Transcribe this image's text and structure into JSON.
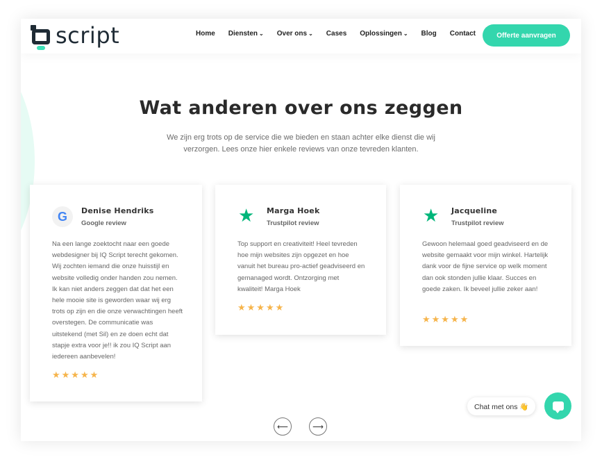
{
  "header": {
    "logo_text": "script",
    "nav": [
      {
        "label": "Home",
        "has_dropdown": false
      },
      {
        "label": "Diensten",
        "has_dropdown": true
      },
      {
        "label": "Over ons",
        "has_dropdown": true
      },
      {
        "label": "Cases",
        "has_dropdown": false
      },
      {
        "label": "Oplossingen",
        "has_dropdown": true
      },
      {
        "label": "Blog",
        "has_dropdown": false
      },
      {
        "label": "Contact",
        "has_dropdown": false
      }
    ],
    "cta_label": "Offerte aanvragen"
  },
  "section": {
    "title": "Wat anderen over ons zeggen",
    "subtitle": "We zijn erg trots op de service die we bieden en staan achter elke dienst die wij verzorgen. Lees onze hier enkele reviews van onze tevreden klanten."
  },
  "reviews": [
    {
      "name": "Denise Hendriks",
      "source": "Google review",
      "icon": "google-icon",
      "icon_glyph": "G",
      "rating": 5,
      "stars": "★★★★★",
      "text": "Na een lange zoektocht naar een goede webdesigner bij IQ Script terecht gekomen. Wij zochten iemand die onze huisstijl en website volledig onder handen zou nemen. Ik kan niet anders zeggen dat dat het een hele mooie site is geworden waar wij erg trots op zijn en die onze verwachtingen heeft overstegen. De communicatie was uitstekend (met Sil) en ze doen echt dat stapje extra voor je!! ik zou IQ Script aan iedereen aanbevelen!"
    },
    {
      "name": "Marga Hoek",
      "source": "Trustpilot review",
      "icon": "trustpilot-star-icon",
      "icon_glyph": "★",
      "rating": 5,
      "stars": "★★★★★",
      "text": "Top support en creativiteit! Heel tevreden hoe mijn websites zijn opgezet en hoe vanuit het bureau pro-actief geadviseerd en gemanaged wordt. Ontzorging met kwaliteit! Marga Hoek"
    },
    {
      "name": "Jacqueline",
      "source": "Trustpilot review",
      "icon": "trustpilot-star-icon",
      "icon_glyph": "★",
      "rating": 5,
      "stars": "★★★★★",
      "text": "Gewoon helemaal goed geadviseerd en de website gemaakt voor mijn winkel. Hartelijk dank voor de fijne service op welk moment dan ook stonden jullie klaar. Succes en goede zaken. Ik beveel jullie zeker aan!"
    }
  ],
  "carousel": {
    "prev_glyph": "⟵",
    "next_glyph": "⟶"
  },
  "chat": {
    "label": "Chat met ons 👋"
  },
  "colors": {
    "accent": "#33d6ad",
    "trustpilot": "#00b67a",
    "star": "#f6b44b",
    "dark": "#1f2b35"
  }
}
